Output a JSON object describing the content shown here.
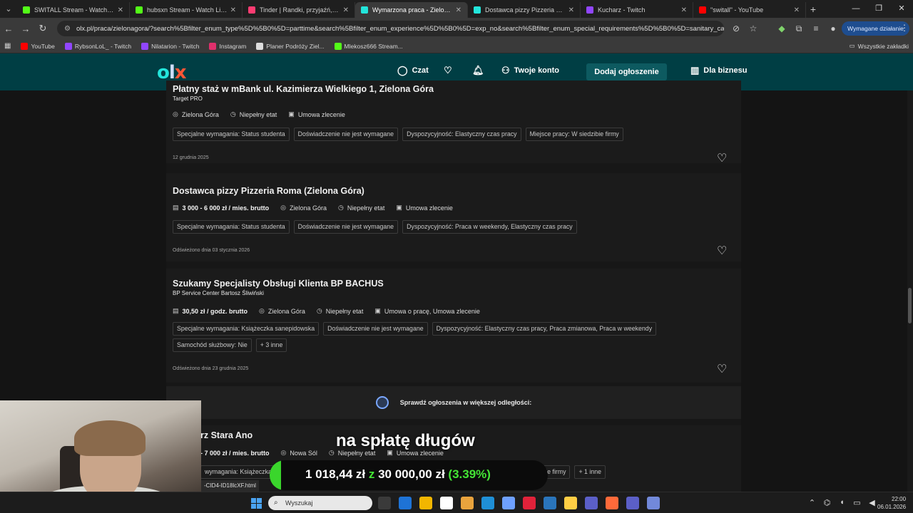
{
  "browser": {
    "tabs": [
      {
        "label": "SWITALL Stream - Watch Live o",
        "color": "#53fc18",
        "active": false
      },
      {
        "label": "hubsxn Stream - Watch Live on",
        "color": "#53fc18",
        "active": false
      },
      {
        "label": "Tinder | Randki, przyjaźń, nowe",
        "color": "#fe3c72",
        "active": false
      },
      {
        "label": "Wymarzona praca - Zielona Gó",
        "color": "#23e5db",
        "active": true
      },
      {
        "label": "Dostawca pizzy Pizzeria Roma",
        "color": "#23e5db",
        "active": false
      },
      {
        "label": "Kucharz - Twitch",
        "color": "#9146ff",
        "active": false
      },
      {
        "label": "\"switall\" - YouTube",
        "color": "#ff0000",
        "active": false
      }
    ],
    "url": "olx.pl/praca/zielonagora/?search%5Bfilter_enum_type%5D%5B0%5D=parttime&search%5Bfilter_enum_experience%5D%5B0%5D=exp_no&search%5Bfilter_enum_special_requirements%5D%5B0%5D=sanitary_card&sea...",
    "action_chip": "Wymagane działanie",
    "bookmarks": [
      {
        "label": "YouTube",
        "color": "#ff0000"
      },
      {
        "label": "RybsonLoL_ - Twitch",
        "color": "#9146ff"
      },
      {
        "label": "Nilatarion - Twitch",
        "color": "#9146ff"
      },
      {
        "label": "Instagram",
        "color": "#e1306c"
      },
      {
        "label": "Planer Podróży Ziel...",
        "color": "#dddddd"
      },
      {
        "label": "Mlekosz666 Stream...",
        "color": "#53fc18"
      }
    ],
    "all_bookmarks": "Wszystkie zakładki"
  },
  "header": {
    "logo": {
      "o": "o",
      "l": "l",
      "x": "x"
    },
    "chat": "Czat",
    "account": "Twoje konto",
    "add_listing": "Dodaj ogłoszenie",
    "business": "Dla biznesu"
  },
  "listings": [
    {
      "title": "Płatny staż w mBank ul. Kazimierza Wielkiego 1, Zielona Góra",
      "company": "Target PRO",
      "salary": "",
      "location": "Zielona Góra",
      "type": "Niepełny etat",
      "contract": "Umowa zlecenie",
      "chips": [
        "Specjalne wymagania: Status studenta",
        "Doświadczenie nie jest wymagane",
        "Dyspozycyjność: Elastyczny czas pracy",
        "Miejsce pracy: W siedzibie firmy"
      ],
      "date": "12 grudnia 2025"
    },
    {
      "title": "Dostawca pizzy Pizzeria Roma (Zielona Góra)",
      "company": "",
      "salary": "3 000 - 6 000 zł / mies. brutto",
      "location": "Zielona Góra",
      "type": "Niepełny etat",
      "contract": "Umowa zlecenie",
      "chips": [
        "Specjalne wymagania: Status studenta",
        "Doświadczenie nie jest wymagane",
        "Dyspozycyjność: Praca w weekendy, Elastyczny czas pracy"
      ],
      "date": "Odświeżono dnia 03 stycznia 2026"
    },
    {
      "title": "Szukamy Specjalisty Obsługi Klienta BP BACHUS",
      "company": "BP Service Center Bartosz Śliwiński",
      "salary": "30,50 zł / godz. brutto",
      "location": "Zielona Góra",
      "type": "Niepełny etat",
      "contract": "Umowa o pracę, Umowa zlecenie",
      "chips": [
        "Specjalne wymagania: Książeczka sanepidowska",
        "Doświadczenie nie jest wymagane",
        "Dyspozycyjność: Elastyczny czas pracy, Praca zmianowa, Praca w weekendy",
        "Samochód służbowy: Nie",
        "+ 3 inne"
      ],
      "date": "Odświeżono dnia 23 grudnia 2025"
    },
    {
      "title": "rz Stara Ano",
      "salary": "- 7 000 zł / mies. brutto",
      "location": "Nowa Sól",
      "type": "Niepełny etat",
      "contract": "Umowa zlecenie",
      "chips": [
        "wymagania: Książeczka sanepi",
        "ezny czas pracy",
        "Miejsce pracy: W siedzibie firmy",
        "+ 1 inne"
      ]
    }
  ],
  "more_distance": "Sprawdź ogłoszenia w większej odległości:",
  "status_url": "-CID4-ID18lcXF.html",
  "overlay": {
    "title": "na spłatę długów",
    "current": "1 018,44 zł",
    "sep": "z",
    "goal": "30 000,00 zł",
    "pct": "(3.39%)",
    "progress": 0.0339
  },
  "taskbar": {
    "search": "Wyszukaj",
    "apps": [
      "#3a3a3a",
      "#1e73d6",
      "#f2b600",
      "#ffffff",
      "#e8a33d",
      "#1f8fd6",
      "#6ea0ff",
      "#e0223a",
      "#2a75bb",
      "#ffce44",
      "#5b5fc7",
      "#ff6a3a",
      "#5b5fc7",
      "#7289da"
    ],
    "time": "22:00",
    "date": "06.01.2026"
  }
}
